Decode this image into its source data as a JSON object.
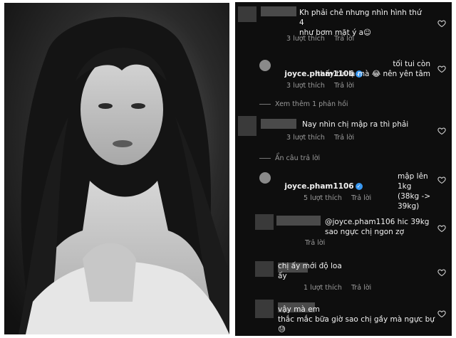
{
  "comments": [
    {
      "text": "Kh phải chê nhưng nhìn hình thứ 4\nnhư bơm mặt ý a☺",
      "likes": "3 lượt thích",
      "reply": "Trả lời"
    },
    {
      "username": "joyce.pham1106",
      "text": "tối tui còn\nthấy tui lạ mà 😂 nên yên tâm",
      "likes": "3 lượt thích",
      "reply": "Trả lời"
    },
    {
      "text": "Nay nhìn chị mập ra thì phải",
      "likes": "3 lượt thích",
      "reply": "Trả lời"
    },
    {
      "username": "joyce.pham1106",
      "text": "mập lên\n1kg (38kg -> 39kg)",
      "likes": "5 lượt thích",
      "reply": "Trả lời"
    },
    {
      "text": "@joyce.pham1106 hic 39kg\nsao ngực chị ngon zợ",
      "reply": "Trả lời"
    },
    {
      "text": "chị ấy mới độ loa\nấy",
      "likes": "1 lượt thích",
      "reply": "Trả lời"
    },
    {
      "text": "vậy mà em\nthắc mắc bữa giờ sao chị gầy mà ngực bự\n😓"
    }
  ],
  "view_more": "Xem thêm 1 phản hồi",
  "hide_replies": "Ẩn câu trả lời",
  "icons": {
    "like": "heart-icon",
    "verified": "verified-badge-icon"
  },
  "colors": {
    "panel_bg": "#0e0e0e",
    "meta": "#9a9a9a",
    "verified": "#3897f0"
  }
}
